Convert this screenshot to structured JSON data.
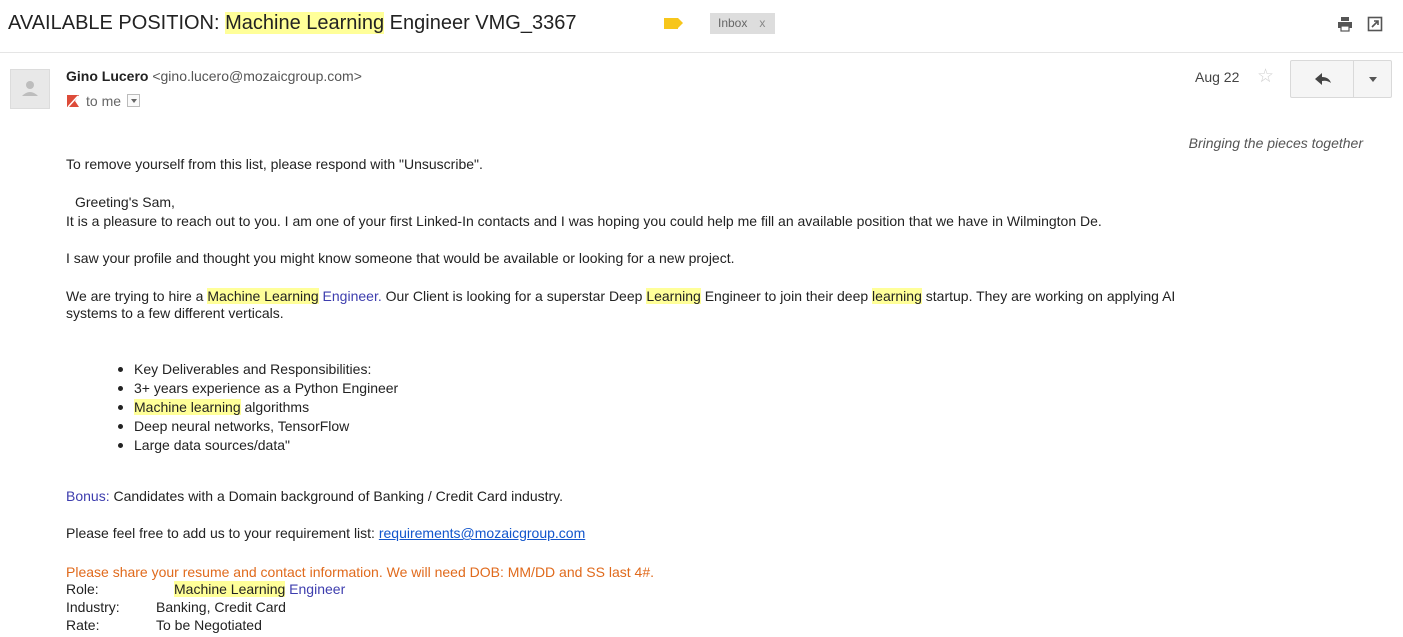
{
  "subject": {
    "prefix": "AVAILABLE POSITION: ",
    "highlight": "Machine Learning",
    "suffix": " Engineer VMG_3367",
    "inbox_chip": "Inbox",
    "inbox_close": "x"
  },
  "sender": {
    "name": "Gino Lucero",
    "email": "<gino.lucero@mozaicgroup.com>",
    "to": "to me",
    "date": "Aug 22"
  },
  "body": {
    "tagline": "Bringing the pieces together",
    "unsubscribe": "To remove yourself from this list, please respond with \"Unsuscribe\".",
    "greeting": "Greeting's Sam,",
    "intro": "It is a pleasure to reach out to you.  I am one of your first Linked-In contacts and I was hoping you could help me fill an available position that we have in Wilmington De.",
    "profile": "I saw your profile and thought you might know someone that would be available or looking for a new project.",
    "hire": {
      "p1": "We are trying to hire a ",
      "h1": "Machine Learning",
      "p2": " Engineer.",
      "p3": "   Our Client is looking for a superstar Deep ",
      "h2": "Learning",
      "p4": " Engineer to join their deep ",
      "h3": "learning",
      "p5": " startup. They are working on applying AI",
      "line2": "systems to a few different verticals."
    },
    "bullets": {
      "b1": "Key Deliverables and Responsibilities:",
      "b2": "3+ years experience as a Python Engineer",
      "b3_hl": "Machine learning",
      "b3_rest": " algorithms",
      "b4": "Deep neural networks, TensorFlow",
      "b5": "Large data sources/data\""
    },
    "bonus": {
      "label": "Bonus:",
      "text": "  Candidates with a Domain background of Banking / Credit Card industry."
    },
    "requirement": {
      "text": "Please feel free to add us to your requirement list: ",
      "link": "requirements@mozaicgroup.com"
    },
    "share": "Please share your resume and contact information. We will need DOB: MM/DD and SS last 4#.",
    "role": {
      "label": "Role:",
      "hl": "Machine Learning",
      "rest": " Engineer"
    },
    "industry": {
      "label": "Industry:",
      "value": "Banking, Credit Card"
    },
    "rate": {
      "label": "Rate:",
      "value": "To be Negotiated"
    }
  },
  "icons": {
    "print": "print-icon",
    "popout": "new-window-icon",
    "star": "star-icon",
    "reply": "reply-icon",
    "more": "chevron-down-icon",
    "flag": "important-marker-icon",
    "label": "label-tag-icon"
  },
  "colors": {
    "highlight": "#ffff99",
    "link": "#1155cc",
    "accent_blue": "#3d3dae",
    "accent_orange": "#e06a1c",
    "label_tag": "#f7c61b"
  }
}
